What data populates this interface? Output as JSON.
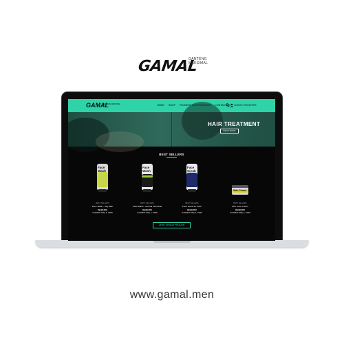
{
  "brand": {
    "name": "GAMAL",
    "tagline_line1": "GANTENG",
    "tagline_line2": "MAKSIMAL"
  },
  "site": {
    "nav": {
      "logo": "GAMAL",
      "logo_tag": "GANTENG MAKSIMAL",
      "links": [
        "HOME",
        "SHOP",
        "PAYMENT CONFIRMATION",
        "CONTACT US"
      ],
      "login": "LOGIN / REGISTER"
    },
    "hero": {
      "title": "HAIR TREATMENT",
      "button": "READ MORE"
    },
    "section_title": "BEST SELLERS",
    "products": [
      {
        "category": "BEST SELLERS",
        "label": "Face Wash",
        "name": "Face Wash - Oily Skin",
        "price": "Rp99,000",
        "available": "Available May 1, 2020",
        "tube_color": "#d9d9d9",
        "band_color": "#c8d64a"
      },
      {
        "category": "BEST SELLERS",
        "label": "Face Wash",
        "name": "Face Wash - Normal Chemical",
        "price": "Rp99,000",
        "available": "Available May 1, 2020",
        "tube_color": "#e8e8e8",
        "band_color": "#9fcc3b"
      },
      {
        "category": "BEST SELLERS",
        "label": "Face Scrub",
        "name": "Face Scrub for Face",
        "price": "Rp99,000",
        "available": "Available May 1, 2020",
        "tube_color": "#ececf2",
        "band_color": "#1e2a6b"
      },
      {
        "category": "BEST SELLERS",
        "label": "Skin Cream",
        "name": "Skin Care Cream",
        "price": "Rp99,000",
        "available": "Available May 1, 2020",
        "tube_color": "#d8d8e0",
        "band_color": "#d9d138"
      }
    ],
    "all_products_button": "LIHAT SEMUA PRODUK"
  },
  "url": "www.gamal.men",
  "colors": {
    "accent": "#2fd3a8",
    "screen_bg": "#070707",
    "text_dark": "#111111"
  },
  "icons": [
    "search-icon",
    "user-icon"
  ]
}
